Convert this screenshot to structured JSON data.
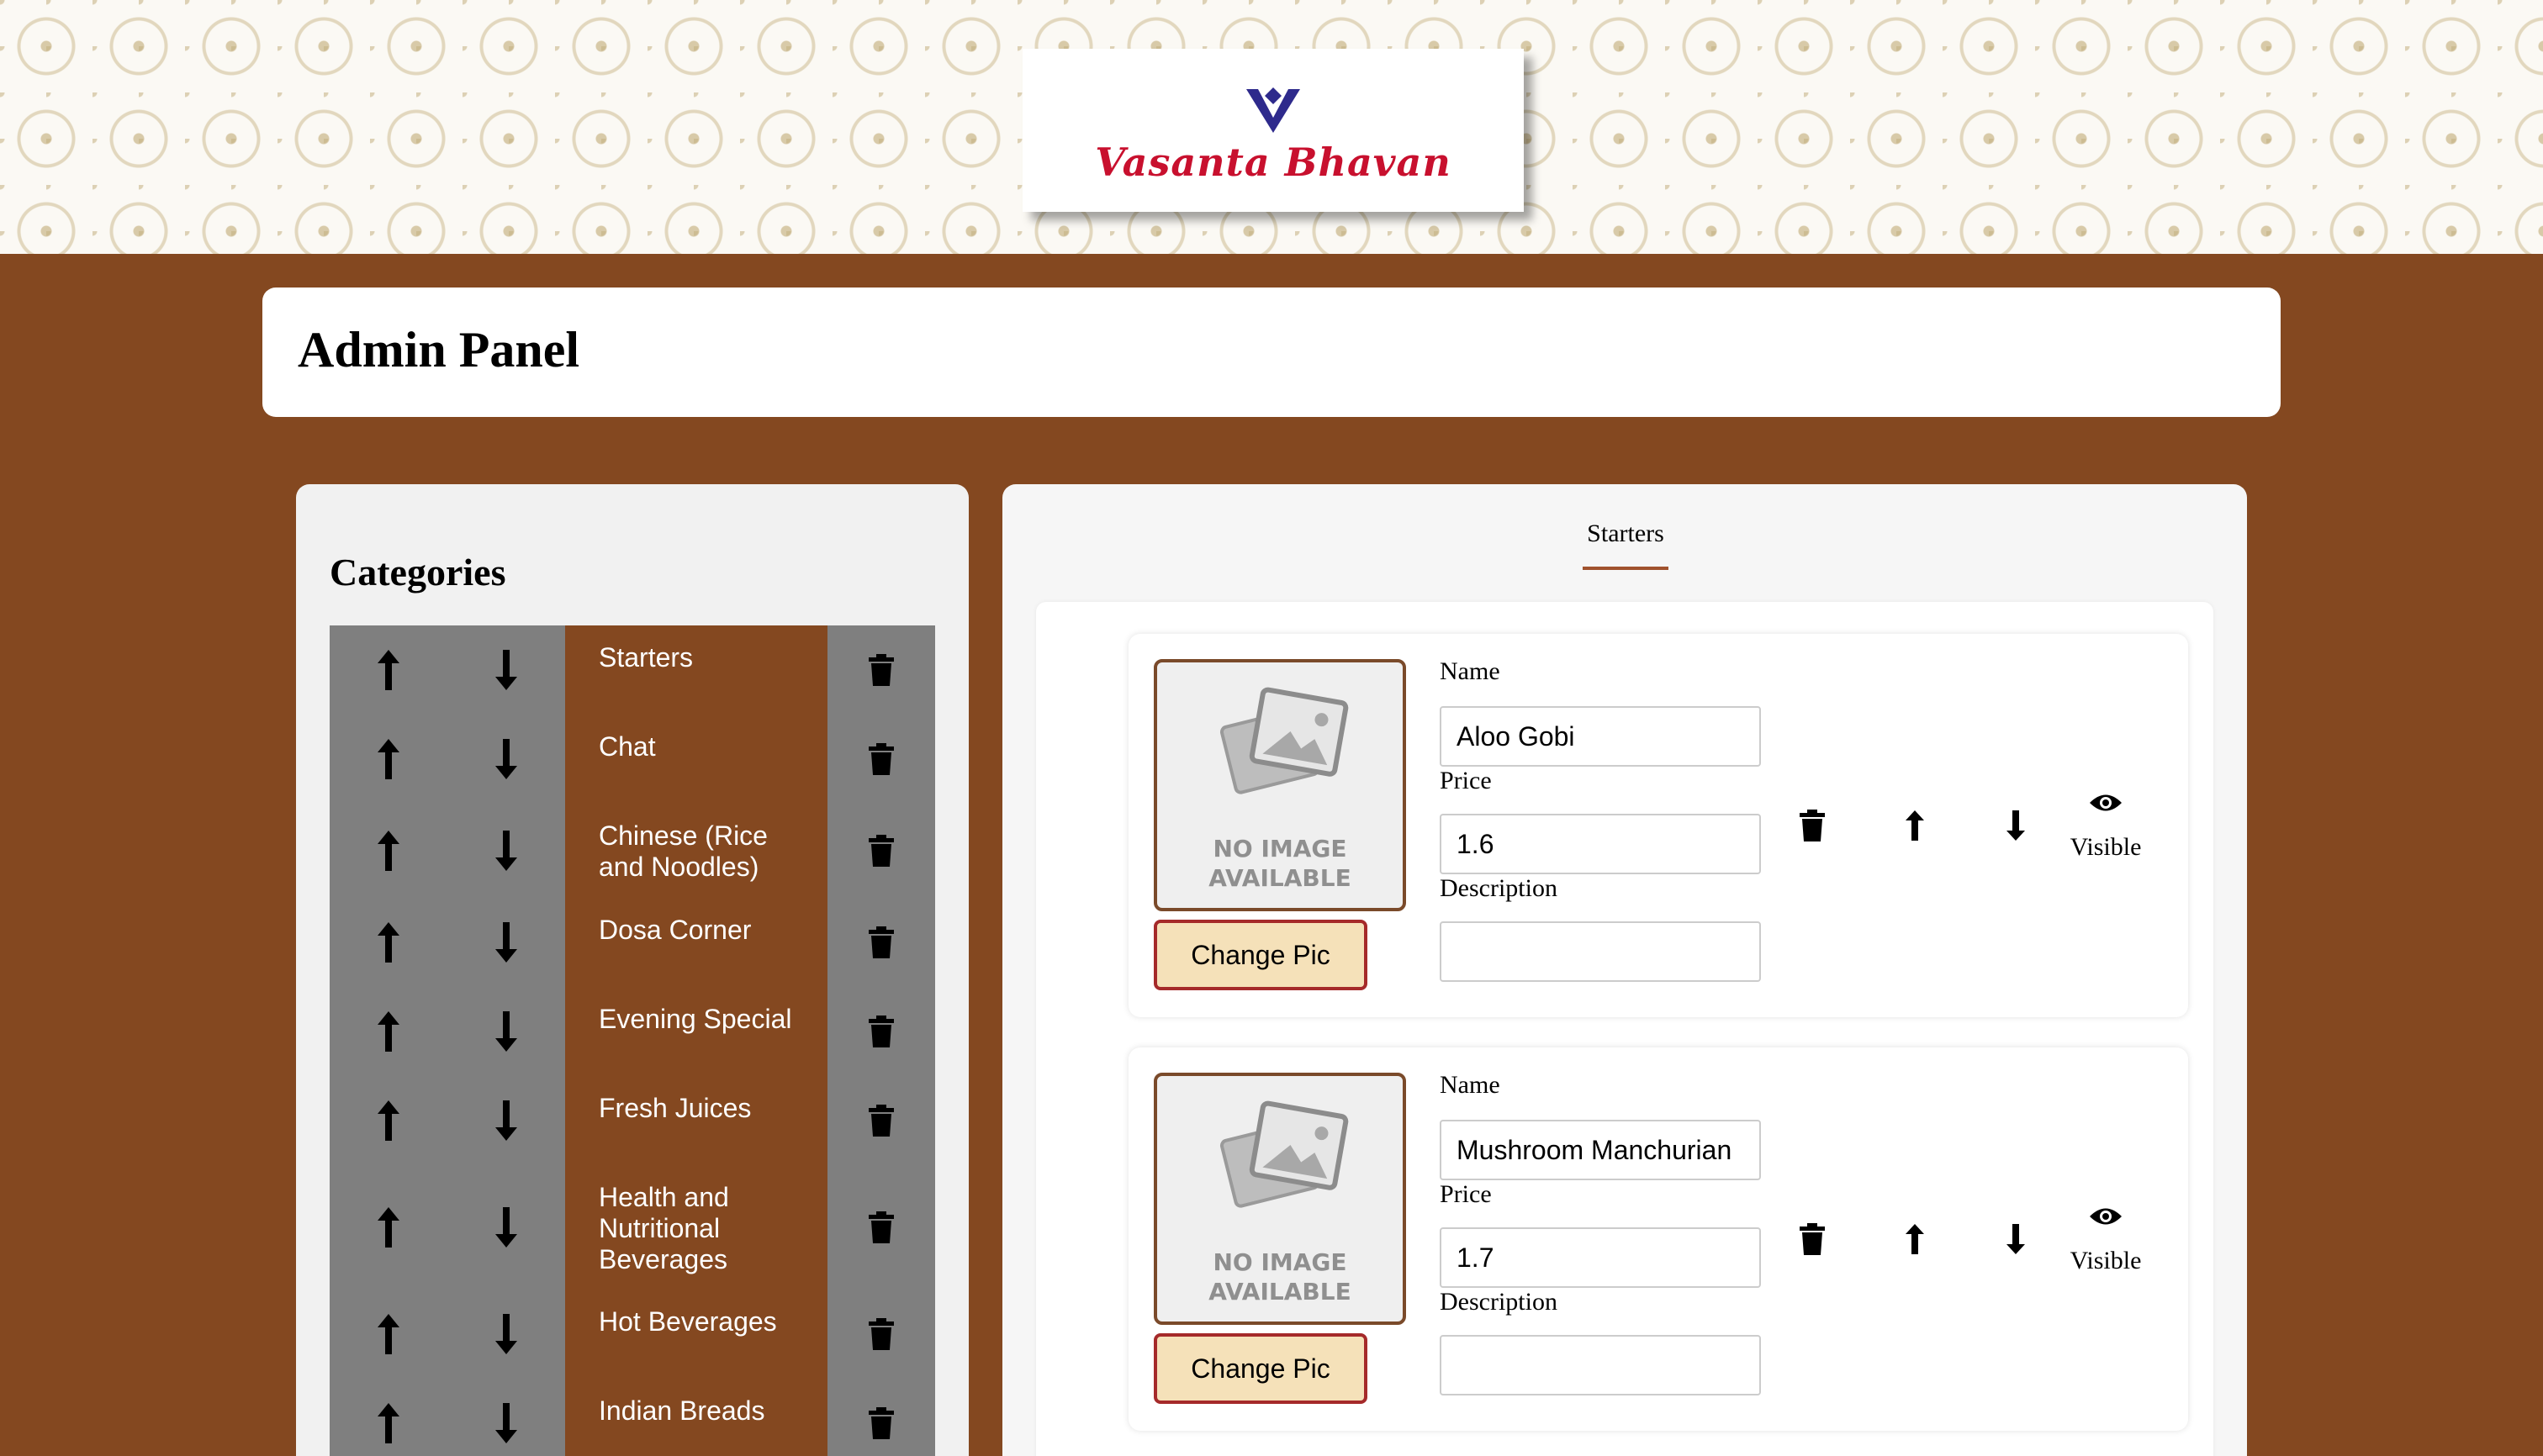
{
  "brand": {
    "name": "Vasanta Bhavan",
    "logo_color": "#2e2a8c",
    "text_color": "#c8102e"
  },
  "header": {
    "title": "Admin Panel"
  },
  "categories": {
    "title": "Categories",
    "items": [
      {
        "label": "Starters"
      },
      {
        "label": "Chat"
      },
      {
        "label": "Chinese (Rice and Noodles)"
      },
      {
        "label": "Dosa Corner"
      },
      {
        "label": "Evening Special"
      },
      {
        "label": "Fresh Juices"
      },
      {
        "label": "Health and Nutritional Beverages"
      },
      {
        "label": "Hot Beverages"
      },
      {
        "label": "Indian Breads"
      }
    ],
    "icons": {
      "up": "arrow-up-icon",
      "down": "arrow-down-icon",
      "delete": "trash-icon"
    }
  },
  "items_panel": {
    "active_tab": "Starters",
    "no_image_text": "NO IMAGE AVAILABLE",
    "labels": {
      "name": "Name",
      "price": "Price",
      "description": "Description",
      "change_pic": "Change Pic",
      "visible": "Visible"
    },
    "items": [
      {
        "name": "Aloo Gobi",
        "price": "1.6",
        "description": ""
      },
      {
        "name": "Mushroom Manchurian",
        "price": "1.7",
        "description": ""
      }
    ]
  },
  "colors": {
    "background": "#844820",
    "button_gray": "#7f7f7f",
    "change_pic_bg": "#f5e1b9",
    "change_pic_border": "#a52a2a"
  }
}
